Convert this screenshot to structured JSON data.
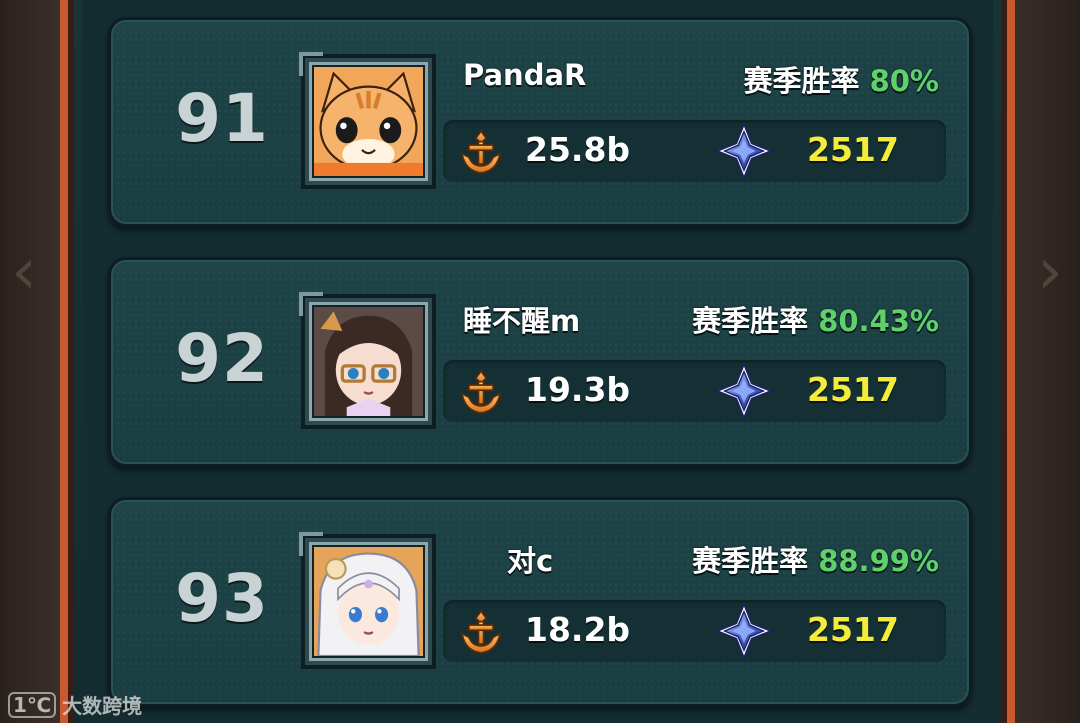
{
  "winrate_label": "赛季胜率",
  "colors": {
    "winrate": "#5fd16a",
    "trophy_value": "#f3ec3c",
    "frame_border": "#c95a2f",
    "card_bg": "#1e4448"
  },
  "icons": {
    "power": "anchor-crest-icon",
    "trophy": "blue-crystal-star-icon"
  },
  "players": [
    {
      "rank": "91",
      "name": "PandaR",
      "winrate": "80%",
      "power": "25.8b",
      "trophy": "2517",
      "avatar": "orange-cat-avatar"
    },
    {
      "rank": "92",
      "name": "睡不醒m",
      "winrate": "80.43%",
      "power": "19.3b",
      "trophy": "2517",
      "avatar": "glasses-girl-avatar"
    },
    {
      "rank": "93",
      "name": "对c",
      "winrate": "88.99%",
      "power": "18.2b",
      "trophy": "2517",
      "avatar": "white-hair-girl-avatar"
    }
  ],
  "watermark": {
    "logo": "1℃",
    "text": "大数跨境"
  }
}
